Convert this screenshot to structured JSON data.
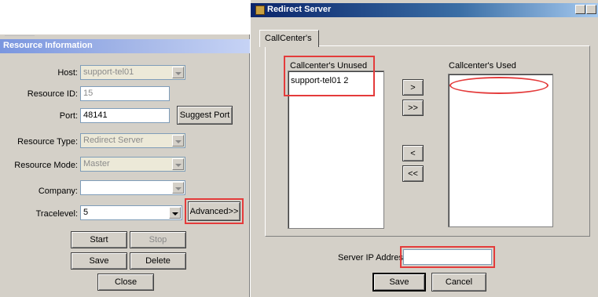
{
  "left_panel": {
    "section_title": "Resource Information",
    "host": {
      "label": "Host:",
      "value": "support-tel01"
    },
    "resource_id": {
      "label": "Resource ID:",
      "value": "15"
    },
    "port": {
      "label": "Port:",
      "value": "48141"
    },
    "suggest_port_label": "Suggest Port",
    "resource_type": {
      "label": "Resource Type:",
      "value": "Redirect Server"
    },
    "resource_mode": {
      "label": "Resource Mode:",
      "value": "Master"
    },
    "company": {
      "label": "Company:",
      "value": ""
    },
    "tracelevel": {
      "label": "Tracelevel:",
      "value": "5"
    },
    "advanced_label": "Advanced>>",
    "buttons": {
      "start": "Start",
      "stop": "Stop",
      "save": "Save",
      "delete": "Delete",
      "close": "Close"
    }
  },
  "right_panel": {
    "window_title": "Redirect Server",
    "tab_label": "CallCenter's",
    "unused_label": "Callcenter's Unused",
    "unused_items": [
      "support-tel01 2"
    ],
    "used_label": "Callcenter's Used",
    "used_items": [],
    "move_buttons": {
      "add": ">",
      "add_all": ">>",
      "remove": "<",
      "remove_all": "<<"
    },
    "server_ip": {
      "label": "Server IP Address:",
      "value": ""
    },
    "save_label": "Save",
    "cancel_label": "Cancel"
  },
  "colors": {
    "highlight_red": "#e43b3b",
    "title_blue": "#0a246a",
    "header_blue": "#7a96df"
  }
}
